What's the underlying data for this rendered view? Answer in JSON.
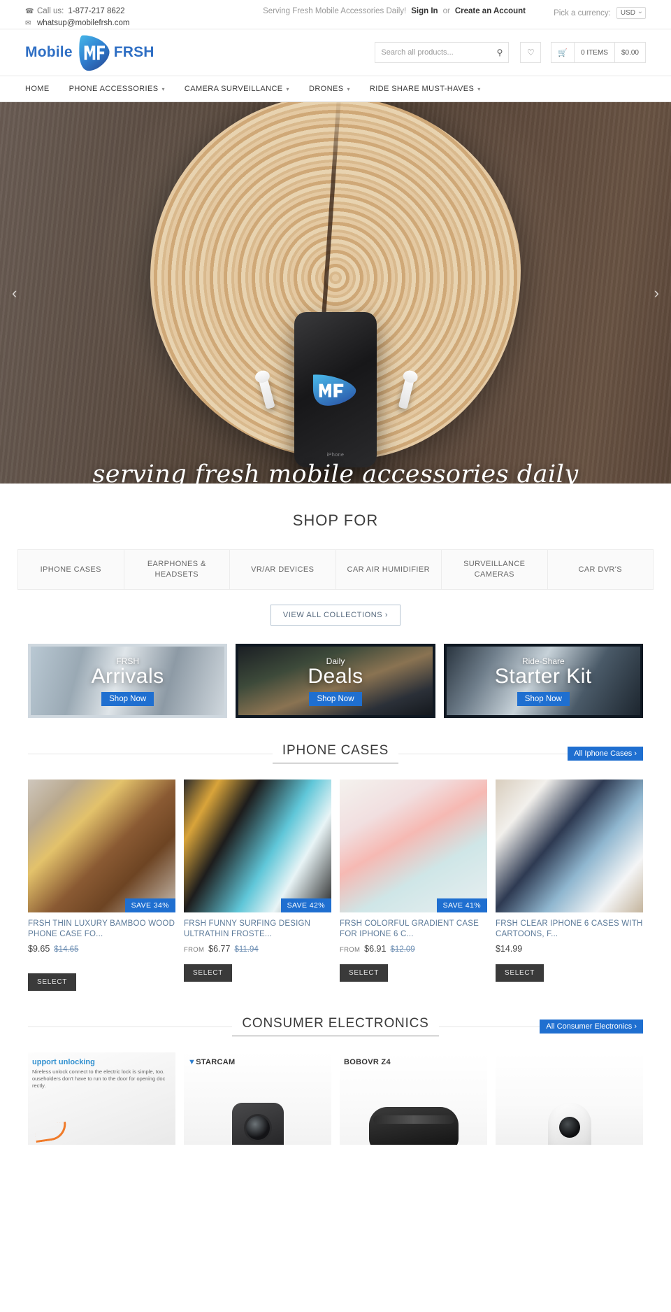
{
  "topbar": {
    "phone_icon": "phone-icon",
    "call_label": "Call us:",
    "phone": "1-877-217 8622",
    "mail_icon": "envelope-icon",
    "email": "whatsup@mobilefrsh.com",
    "tagline": "Serving Fresh Mobile Accessories Daily!",
    "sign_in": "Sign In",
    "or": "or",
    "create_account": "Create an Account",
    "currency_label": "Pick a currency:",
    "currency_value": "USD"
  },
  "header": {
    "logo_left": "Mobile",
    "logo_mark": "MF",
    "logo_right": "FRSH",
    "search_placeholder": "Search all products...",
    "search_value": "",
    "wishlist_icon": "heart-icon",
    "cart_icon": "cart-icon",
    "cart_items": "0 ITEMS",
    "cart_total": "$0.00"
  },
  "nav": {
    "items": [
      {
        "label": "HOME",
        "has_caret": false
      },
      {
        "label": "PHONE ACCESSORIES",
        "has_caret": true
      },
      {
        "label": "CAMERA SURVEILLANCE",
        "has_caret": true
      },
      {
        "label": "DRONES",
        "has_caret": true
      },
      {
        "label": "RIDE SHARE MUST-HAVES",
        "has_caret": true
      }
    ]
  },
  "hero": {
    "caption": "serving fresh mobile accessories daily",
    "phone_brand": "iPhone",
    "prev_icon": "chevron-left-icon",
    "next_icon": "chevron-right-icon"
  },
  "shop_for": {
    "title": "SHOP FOR",
    "categories": [
      "IPHONE CASES",
      "EARPHONES & HEADSETS",
      "VR/AR DEVICES",
      "CAR AIR HUMIDIFIER",
      "SURVEILLANCE CAMERAS",
      "CAR DVR'S"
    ],
    "view_all": "VIEW ALL COLLECTIONS ›"
  },
  "promos": [
    {
      "sub": "FRSH",
      "title": "Arrivals",
      "button": "Shop Now"
    },
    {
      "sub": "Daily",
      "title": "Deals",
      "button": "Shop Now"
    },
    {
      "sub": "Ride-Share",
      "title": "Starter Kit",
      "button": "Shop Now"
    }
  ],
  "iphone_cases": {
    "heading": "IPHONE CASES",
    "all_link": "All Iphone Cases ›",
    "products": [
      {
        "title": "FRSH THIN LUXURY BAMBOO WOOD PHONE CASE FO...",
        "badge": "SAVE 34%",
        "from": "",
        "price": "$9.65",
        "was": "$14.65",
        "button": "SELECT"
      },
      {
        "title": "FRSH FUNNY SURFING DESIGN ULTRATHIN FROSTE...",
        "badge": "SAVE 42%",
        "from": "FROM",
        "price": "$6.77",
        "was": "$11.94",
        "button": "SELECT"
      },
      {
        "title": "FRSH COLORFUL GRADIENT CASE FOR IPHONE 6 C...",
        "badge": "SAVE 41%",
        "from": "FROM",
        "price": "$6.91",
        "was": "$12.09",
        "button": "SELECT"
      },
      {
        "title": "FRSH CLEAR IPHONE 6 CASES WITH CARTOONS, F...",
        "badge": "",
        "from": "",
        "price": "$14.99",
        "was": "",
        "button": "SELECT"
      }
    ]
  },
  "consumer_electronics": {
    "heading": "CONSUMER ELECTRONICS",
    "all_link": "All Consumer Electronics ›",
    "tiles": [
      {
        "head": "upport unlocking",
        "body": "Nireless unlock connect to the electric lock is simple, too. ouseholders don't have to run to the door for opening doc rectly.",
        "logo": ""
      },
      {
        "head": "",
        "body": "",
        "logo": "STARCAM"
      },
      {
        "head": "",
        "body": "",
        "logo": "BOBOVR Z4"
      },
      {
        "head": "",
        "body": "",
        "logo": ""
      }
    ]
  }
}
